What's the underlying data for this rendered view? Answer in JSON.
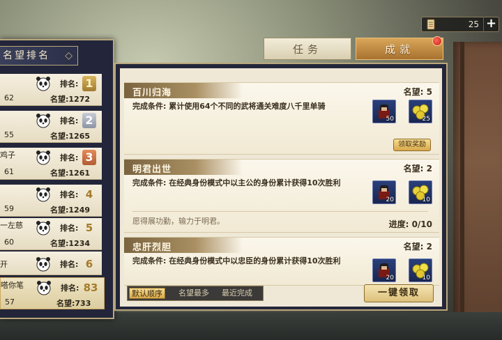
{
  "currency": {
    "value": "25",
    "plus": "+"
  },
  "ranking": {
    "title": "名望排名",
    "rank_label": "排名:",
    "fame_label": "名望:",
    "rows": [
      {
        "name": "",
        "left_num": "62",
        "rank": "1",
        "fame": "1272",
        "badge": "gold"
      },
      {
        "name": "",
        "left_num": "55",
        "rank": "2",
        "fame": "1265",
        "badge": "silver"
      },
      {
        "name": "鸡子",
        "left_num": "61",
        "rank": "3",
        "fame": "1261",
        "badge": "bronze"
      },
      {
        "name": "",
        "left_num": "59",
        "rank": "4",
        "fame": "1249",
        "badge": "plain"
      },
      {
        "name": "一左慈",
        "left_num": "60",
        "rank": "5",
        "fame": "1234",
        "badge": "plain"
      },
      {
        "name": "开",
        "left_num": "",
        "rank": "6",
        "fame": "",
        "badge": "plain"
      },
      {
        "name": "嗒你笔",
        "left_num": "57",
        "rank": "83",
        "fame": "733",
        "badge": "plain"
      }
    ]
  },
  "tabs": {
    "mission": "任务",
    "achievement": "成就"
  },
  "achievements": {
    "fame_label": "名望:",
    "cond_label": "完成条件:",
    "items": [
      {
        "title": "百川归海",
        "fame": "5",
        "condition": "累计使用64个不同的武将通关难度八千里单骑",
        "reward1_qty": "50",
        "reward2_qty": "25",
        "claim": "领取奖励"
      },
      {
        "title": "明君出世",
        "fame": "2",
        "condition": "在经典身份模式中以主公的身份累计获得10次胜利",
        "reward1_qty": "20",
        "reward2_qty": "10",
        "flavor": "愿得展功勤，输力于明君。",
        "progress_label": "进度:",
        "progress": "0/10"
      },
      {
        "title": "忠肝烈胆",
        "fame": "2",
        "condition": "在经典身份模式中以忠臣的身份累计获得10次胜利",
        "reward1_qty": "20",
        "reward2_qty": "10"
      }
    ]
  },
  "sort": {
    "default": "默认顺序",
    "fame_most": "名望最多",
    "nearly_done": "最近完成"
  },
  "onekey": "一键领取"
}
